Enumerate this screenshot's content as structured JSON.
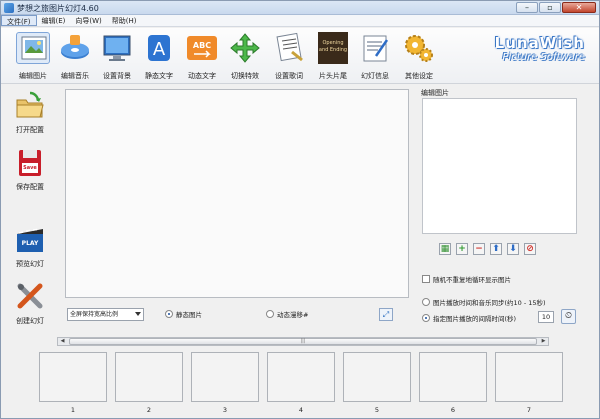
{
  "window": {
    "title": "梦想之旅图片幻灯4.60",
    "controls": [
      "–",
      "▫",
      "✕"
    ]
  },
  "menu": [
    {
      "label": "文件(F)",
      "active": true
    },
    {
      "label": "编辑(E)",
      "active": false
    },
    {
      "label": "向导(W)",
      "active": false
    },
    {
      "label": "帮助(H)",
      "active": false
    }
  ],
  "toolbar": [
    {
      "label": "编辑图片",
      "icon": "edit-picture-icon",
      "selected": true
    },
    {
      "label": "编辑音乐",
      "icon": "edit-music-icon"
    },
    {
      "label": "设置背景",
      "icon": "set-background-icon"
    },
    {
      "label": "静态文字",
      "icon": "static-text-icon"
    },
    {
      "label": "动态文字",
      "icon": "dynamic-text-icon"
    },
    {
      "label": "切换特效",
      "icon": "transition-effect-icon"
    },
    {
      "label": "设置歌词",
      "icon": "set-lyrics-icon"
    },
    {
      "label": "片头片尾",
      "icon": "opening-ending-icon"
    },
    {
      "label": "幻灯信息",
      "icon": "slideshow-info-icon"
    },
    {
      "label": "其他设定",
      "icon": "other-settings-icon"
    }
  ],
  "toolbar_film_text": {
    "line1": "Opening",
    "line2": "and Ending"
  },
  "brand": {
    "line1": "LunaWish",
    "line2": "Picture Software"
  },
  "sidebar": [
    {
      "label": "打开配置",
      "icon": "open-config-icon"
    },
    {
      "label": "保存配置",
      "icon": "save-config-icon",
      "badge": "Save"
    },
    {
      "label": "预览幻灯",
      "icon": "preview-slideshow-icon",
      "badge": "PLAY"
    },
    {
      "label": "创建幻灯",
      "icon": "create-slideshow-icon"
    }
  ],
  "controls": {
    "fit_mode": "全屏保持宽高比例",
    "radio_static": "静态图片",
    "radio_pan": "动态漫移#"
  },
  "right_panel": {
    "label": "编辑图片",
    "buttons": [
      {
        "icon": "grid-icon",
        "glyph": "▦"
      },
      {
        "icon": "add-icon",
        "glyph": "+"
      },
      {
        "icon": "remove-icon",
        "glyph": "−"
      },
      {
        "icon": "move-up-icon",
        "glyph": "⬆"
      },
      {
        "icon": "move-down-icon",
        "glyph": "⬇"
      },
      {
        "icon": "delete-icon",
        "glyph": "⊘"
      }
    ],
    "random_checkbox": "随机不重复地循环显示图片",
    "opt_sync": "图片播放时间和音乐同步(约10 - 15秒)",
    "opt_fixed": "指定图片播放的间隔时间(秒)",
    "interval": "10"
  },
  "scrollbar": {
    "grip": "|||"
  },
  "thumbnails": [
    "1",
    "2",
    "3",
    "4",
    "5",
    "6",
    "7"
  ]
}
